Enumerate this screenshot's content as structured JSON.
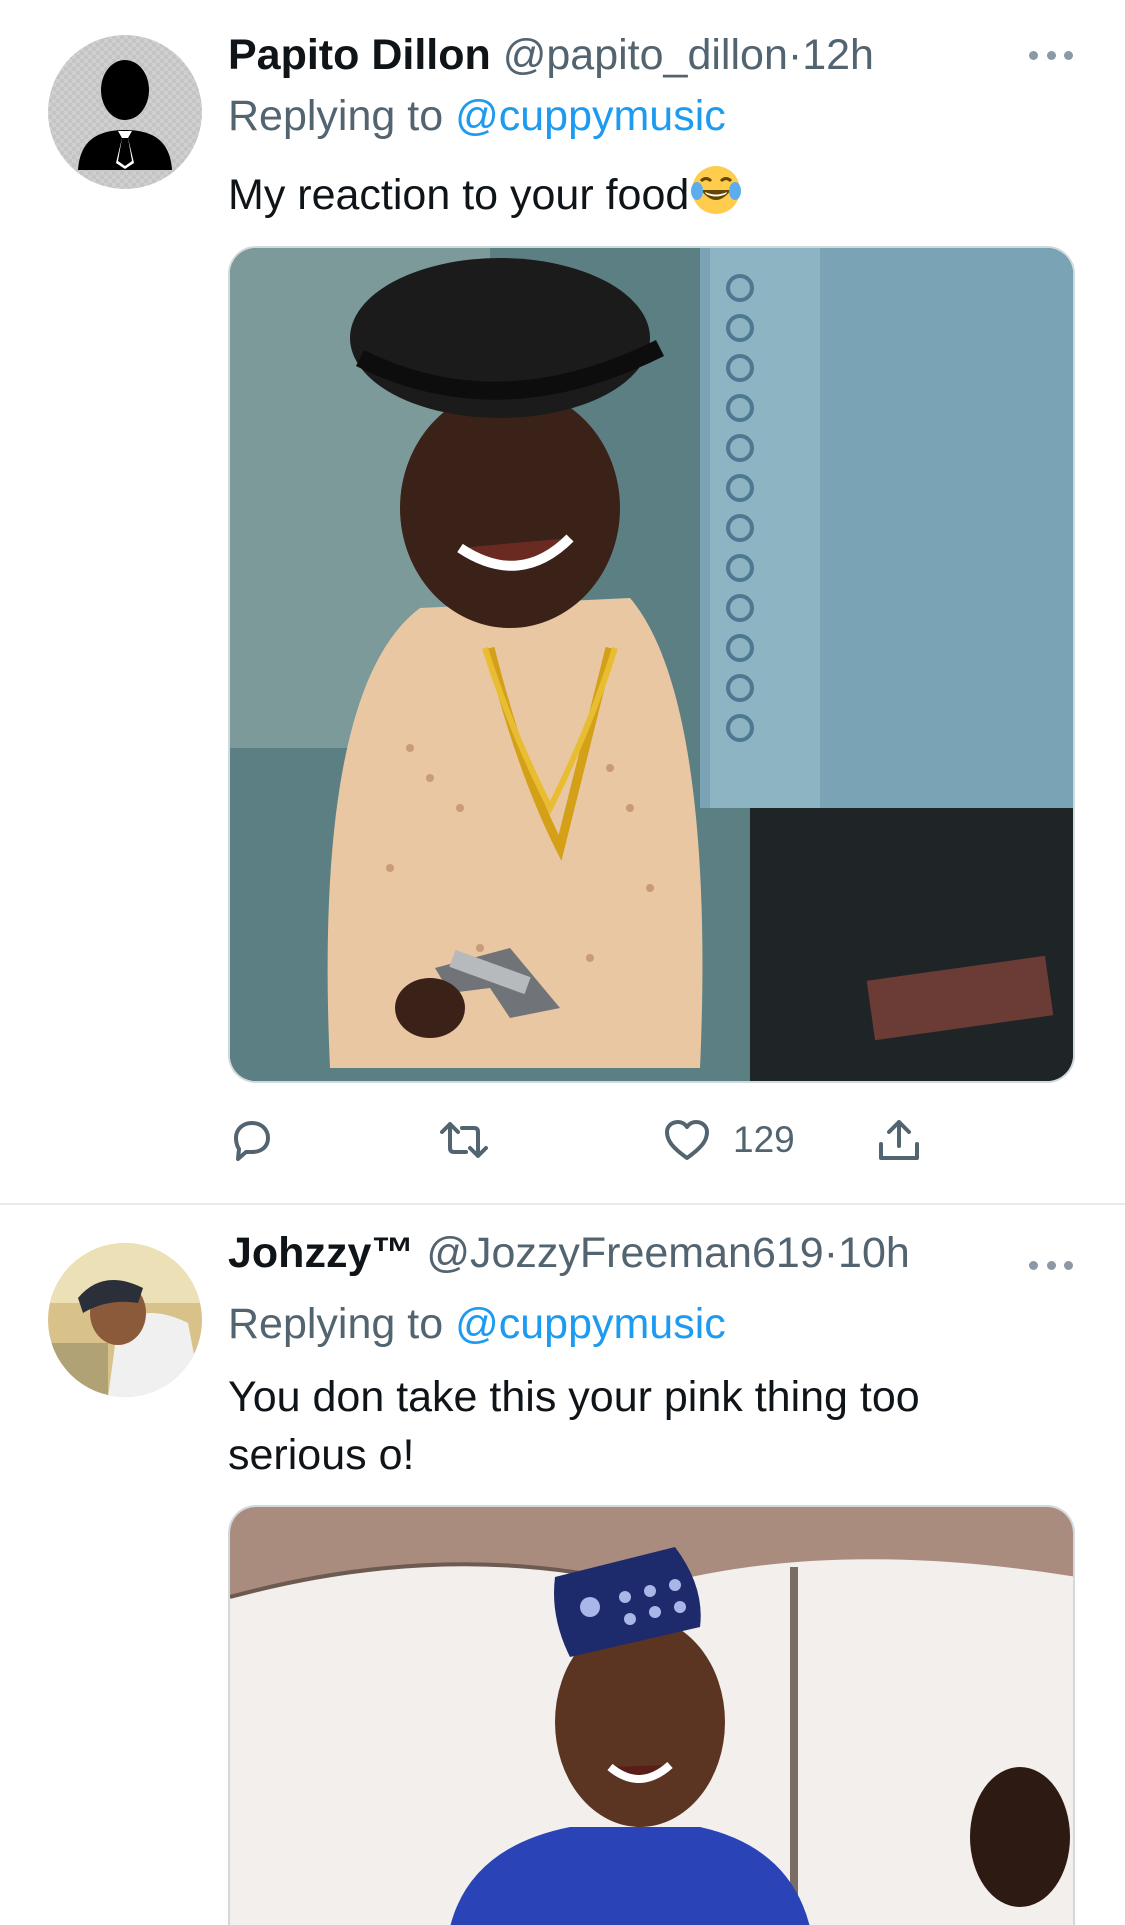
{
  "tweets": [
    {
      "display_name": "Papito Dillon",
      "handle": "@papito_dillon",
      "separator": "·",
      "time": "12h",
      "replying_prefix": "Replying to",
      "replying_to": "@cuppymusic",
      "text": "My reaction to your food",
      "emoji": "face-with-tears-of-joy",
      "actions": {
        "reply_count": "",
        "retweet_count": "",
        "like_count": "129",
        "share": ""
      }
    },
    {
      "display_name": "Johzzy™",
      "handle": "@JozzyFreeman619",
      "separator": "·",
      "time": "10h",
      "replying_prefix": "Replying to",
      "replying_to": "@cuppymusic",
      "text": "You don take this your pink thing too serious o!"
    }
  ],
  "colors": {
    "link_blue": "#1d9bf0",
    "secondary_text": "#536471",
    "primary_text": "#0f1419",
    "divider": "#e7e9ea"
  }
}
